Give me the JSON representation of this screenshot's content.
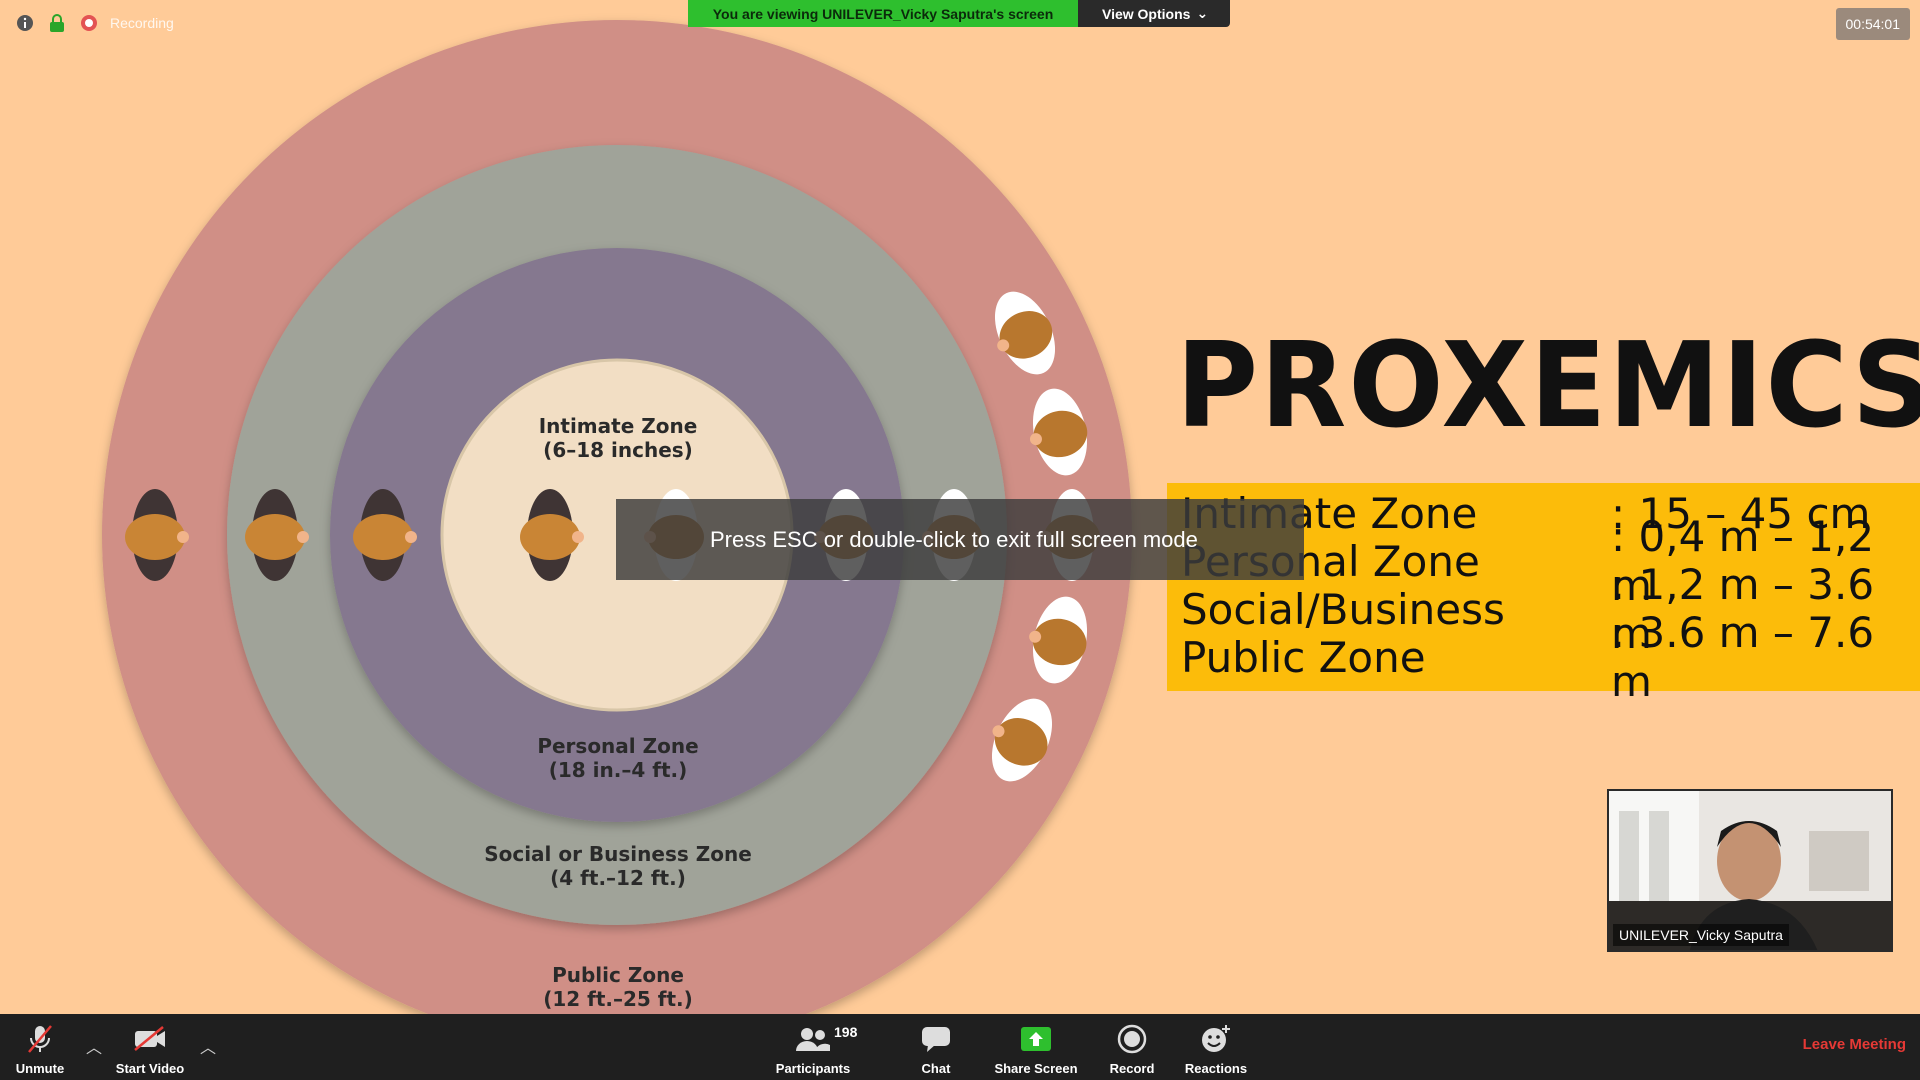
{
  "status": {
    "recording_label": "Recording"
  },
  "banner": {
    "viewing_text": "You are viewing UNILEVER_Vicky Saputra's screen",
    "view_options_label": "View Options"
  },
  "timer": "00:54:01",
  "slide": {
    "title": "PROXEMICS",
    "zones_diagram": [
      {
        "name": "Intimate Zone",
        "range": "(6–18 inches)"
      },
      {
        "name": "Personal Zone",
        "range": "(18 in.–4 ft.)"
      },
      {
        "name": "Social or Business Zone",
        "range": "(4 ft.–12 ft.)"
      },
      {
        "name": "Public Zone",
        "range": "(12 ft.–25 ft.)"
      }
    ],
    "zones_table": [
      {
        "name": "Intimate Zone",
        "range": ": 15 – 45 cm"
      },
      {
        "name": "Personal Zone",
        "range": ": 0,4 m – 1,2 m"
      },
      {
        "name": "Social/Business",
        "range": ": 1,2 m – 3.6 m"
      },
      {
        "name": "Public Zone",
        "range": ": 3.6 m – 7.6 m"
      }
    ],
    "colors": {
      "background": "#ffcb98",
      "public": "#d08f86",
      "social": "#a0a399",
      "personal": "#85788f",
      "intimate": "#f2dec4",
      "table": "#fcbc0a"
    }
  },
  "overlay": {
    "esc_text": "Press ESC or double-click to exit full screen mode"
  },
  "video": {
    "name": "UNILEVER_Vicky Saputra"
  },
  "toolbar": {
    "unmute": "Unmute",
    "start_video": "Start Video",
    "participants": "Participants",
    "participants_count": "198",
    "chat": "Chat",
    "share_screen": "Share Screen",
    "record": "Record",
    "reactions": "Reactions",
    "leave": "Leave Meeting"
  }
}
